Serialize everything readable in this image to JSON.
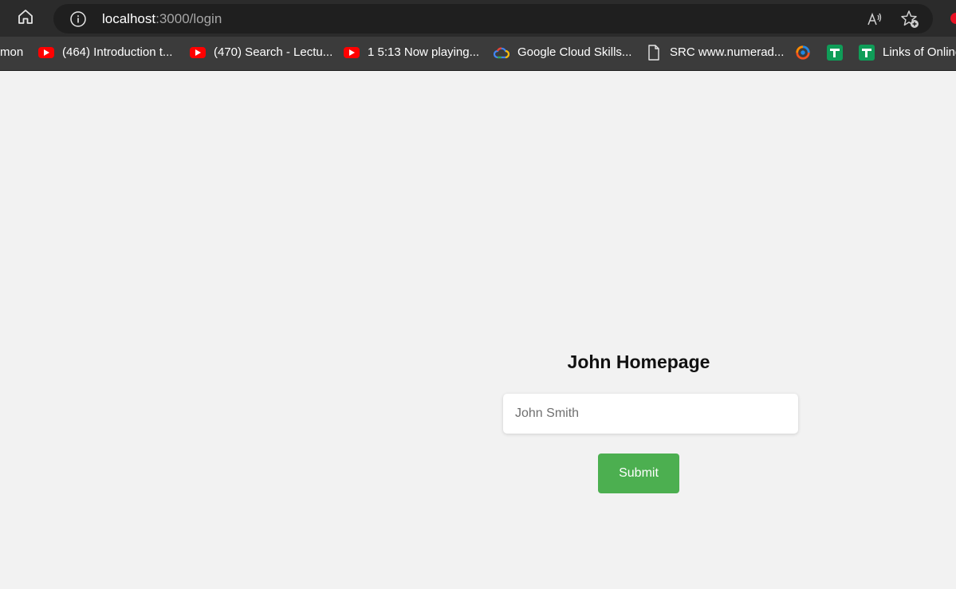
{
  "browser": {
    "url_host": "localhost",
    "url_path": ":3000/login",
    "icons": {
      "home": "home-icon",
      "site_info": "info-icon",
      "read_aloud": "read-aloud-icon",
      "favorites": "add-favorite-icon"
    },
    "bookmarks": [
      {
        "label": "mon",
        "icon": "none"
      },
      {
        "label": "(464) Introduction t...",
        "icon": "youtube-icon"
      },
      {
        "label": "(470) Search - Lectu...",
        "icon": "youtube-icon"
      },
      {
        "label": "1 5:13 Now playing...",
        "icon": "youtube-icon"
      },
      {
        "label": "Google Cloud Skills...",
        "icon": "google-cloud-icon"
      },
      {
        "label": "SRC www.numerad...",
        "icon": "page-icon"
      },
      {
        "label": "",
        "icon": "colorful-app-icon"
      },
      {
        "label": "",
        "icon": "sheets-icon"
      },
      {
        "label": "Links of Online",
        "icon": "sheets-icon"
      }
    ]
  },
  "page": {
    "title": "John Homepage",
    "input_placeholder": "John Smith",
    "submit_label": "Submit"
  },
  "colors": {
    "page_background": "#f2f2f2",
    "submit_button": "#4caf50",
    "chrome_dark": "#2b2b2b"
  }
}
